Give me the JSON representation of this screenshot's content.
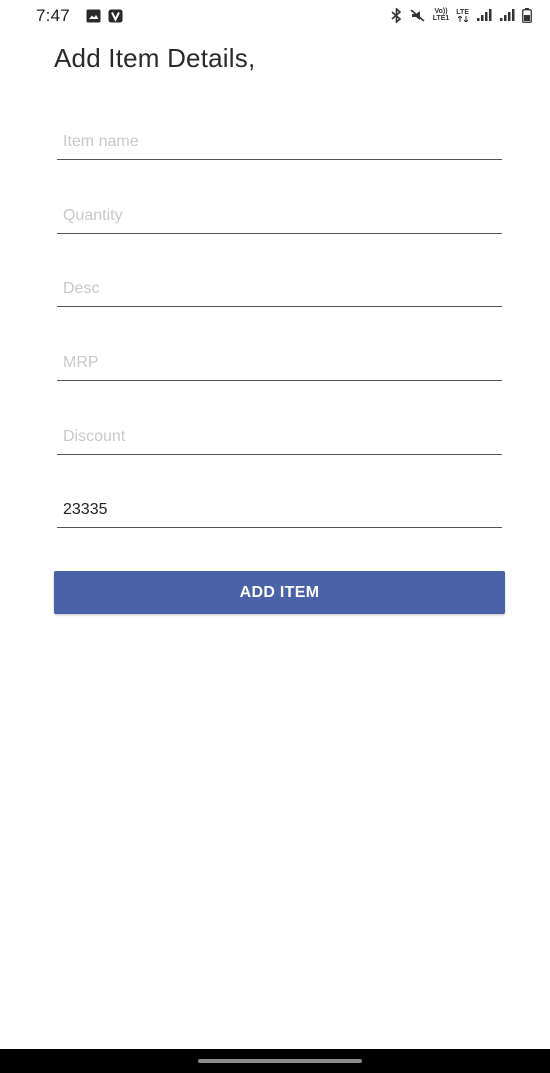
{
  "status_bar": {
    "time": "7:47",
    "left_icons": [
      "gallery-icon",
      "v-app-icon"
    ],
    "right_icons": [
      "bluetooth-icon",
      "mute-icon",
      "volte-icon",
      "lte-icon",
      "signal-1-icon",
      "signal-2-icon",
      "battery-icon"
    ],
    "volte_line1": "Vo))",
    "volte_line2": "LTE1",
    "lte_label": "LTE"
  },
  "page": {
    "title": "Add Item Details,"
  },
  "form": {
    "item_name": {
      "value": "",
      "placeholder": "Item name"
    },
    "quantity": {
      "value": "",
      "placeholder": "Quantity"
    },
    "desc": {
      "value": "",
      "placeholder": "Desc"
    },
    "mrp": {
      "value": "",
      "placeholder": "MRP"
    },
    "discount": {
      "value": "",
      "placeholder": "Discount"
    },
    "code": {
      "value": "23335",
      "placeholder": ""
    },
    "submit_label": "ADD ITEM"
  },
  "colors": {
    "accent": "#4a62a8",
    "underline": "#555555",
    "placeholder": "#c9c9c9",
    "nav_bar": "#000000"
  }
}
